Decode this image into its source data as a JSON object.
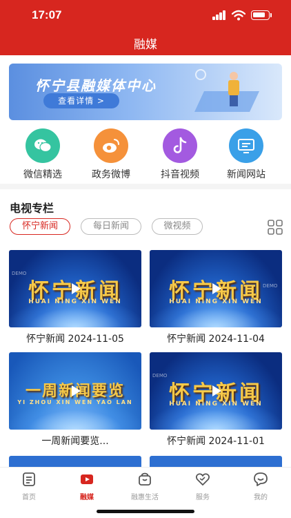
{
  "status_bar": {
    "time": "17:07"
  },
  "nav": {
    "title": "融媒"
  },
  "banner": {
    "title": "怀宁县融媒体中心",
    "button_label": "查看详情 >"
  },
  "quick_links": [
    {
      "label": "微信精选",
      "icon": "wechat-icon",
      "color": "#35c4a0"
    },
    {
      "label": "政务微博",
      "icon": "weibo-icon",
      "color": "#f5913a"
    },
    {
      "label": "抖音视频",
      "icon": "tiktok-icon",
      "color": "#a35ae0"
    },
    {
      "label": "新闻网站",
      "icon": "monitor-icon",
      "color": "#3aa0e8"
    }
  ],
  "tv_section": {
    "title": "电视专栏",
    "filters": [
      "怀宁新闻",
      "每日新闻",
      "微视频"
    ],
    "active_filter": "怀宁新闻"
  },
  "videos": [
    {
      "thumb_title": "怀宁新闻",
      "thumb_sub": "HUAI NING XIN WEN",
      "caption": "怀宁新闻 2024-11-05"
    },
    {
      "thumb_title": "怀宁新闻",
      "thumb_sub": "HUAI NING XIN WEN",
      "caption": "怀宁新闻 2024-11-04"
    },
    {
      "thumb_title": "一周新闻要览",
      "thumb_sub": "YI ZHOU XIN WEN YAO LAN",
      "caption": "一周新闻要览..."
    },
    {
      "thumb_title": "怀宁新闻",
      "thumb_sub": "HUAI NING XIN WEN",
      "caption": "怀宁新闻 2024-11-01"
    }
  ],
  "watermark": "DEMO",
  "tabbar": [
    {
      "label": "首页",
      "icon": "home-icon",
      "active": false
    },
    {
      "label": "融媒",
      "icon": "video-icon",
      "active": true
    },
    {
      "label": "融惠生活",
      "icon": "bag-icon",
      "active": false
    },
    {
      "label": "服务",
      "icon": "heart-icon",
      "active": false
    },
    {
      "label": "我的",
      "icon": "chat-face-icon",
      "active": false
    }
  ],
  "colors": {
    "brand_red": "#d7261f",
    "inactive_gray": "#999999"
  }
}
